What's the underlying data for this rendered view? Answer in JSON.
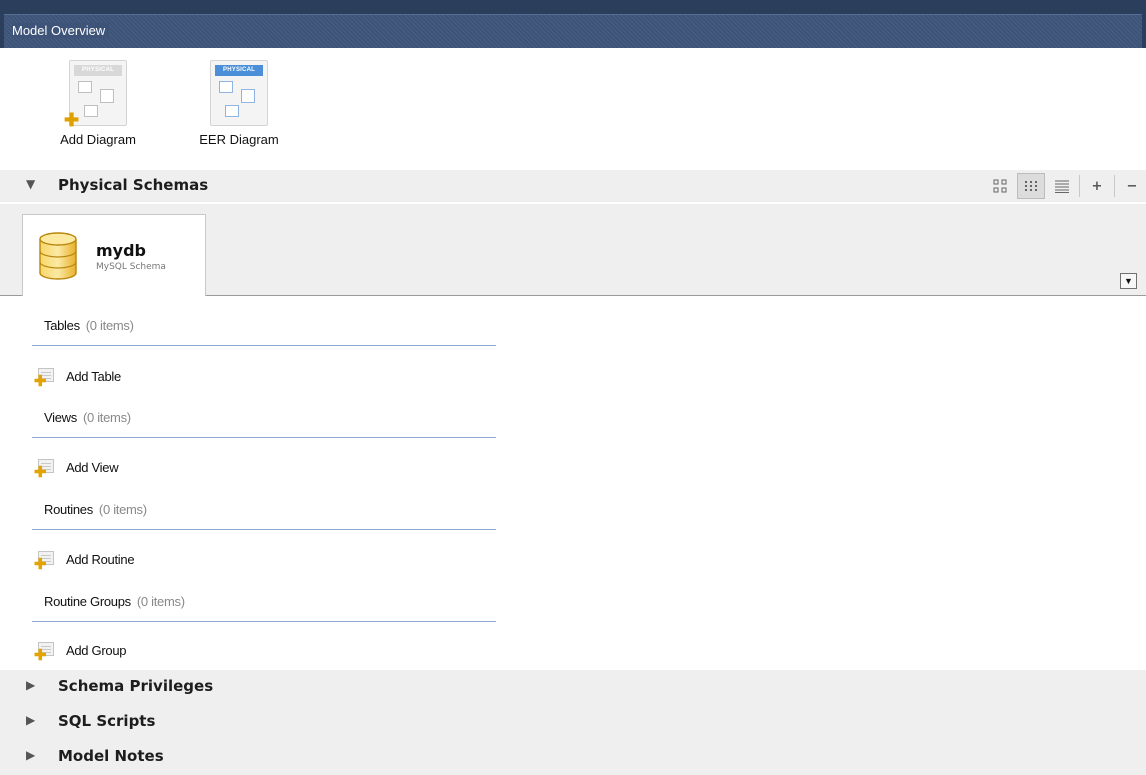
{
  "window": {
    "title": "Model Overview"
  },
  "diagrams": [
    {
      "label": "Add Diagram",
      "band": "PHYSICAL",
      "icon": "add-diagram-icon"
    },
    {
      "label": "EER Diagram",
      "band": "PHYSICAL",
      "icon": "eer-diagram-icon"
    }
  ],
  "physical_schemas": {
    "header": "Physical Schemas",
    "expanded_arrow": "▼",
    "tools": [
      "large-icons-view-icon",
      "small-icons-view-icon",
      "list-view-icon",
      "add-icon",
      "remove-icon"
    ],
    "tool_glyphs": {
      "plus": "+",
      "minus": "−"
    },
    "schema": {
      "name": "mydb",
      "type": "MySQL Schema"
    },
    "dropdown_glyph": "▼",
    "groups": [
      {
        "title": "Tables",
        "count": "(0 items)",
        "add_label": "Add Table"
      },
      {
        "title": "Views",
        "count": "(0 items)",
        "add_label": "Add View"
      },
      {
        "title": "Routines",
        "count": "(0 items)",
        "add_label": "Add Routine"
      },
      {
        "title": "Routine Groups",
        "count": "(0 items)",
        "add_label": "Add Group"
      }
    ]
  },
  "collapsed_sections": {
    "arrow": "▶",
    "items": [
      "Schema Privileges",
      "SQL Scripts",
      "Model Notes"
    ]
  },
  "colors": {
    "titlebar": "#2b3e5c",
    "accent_line": "#8fa8d4",
    "plus": "#e3a400",
    "db_icon": "#f5c842"
  }
}
